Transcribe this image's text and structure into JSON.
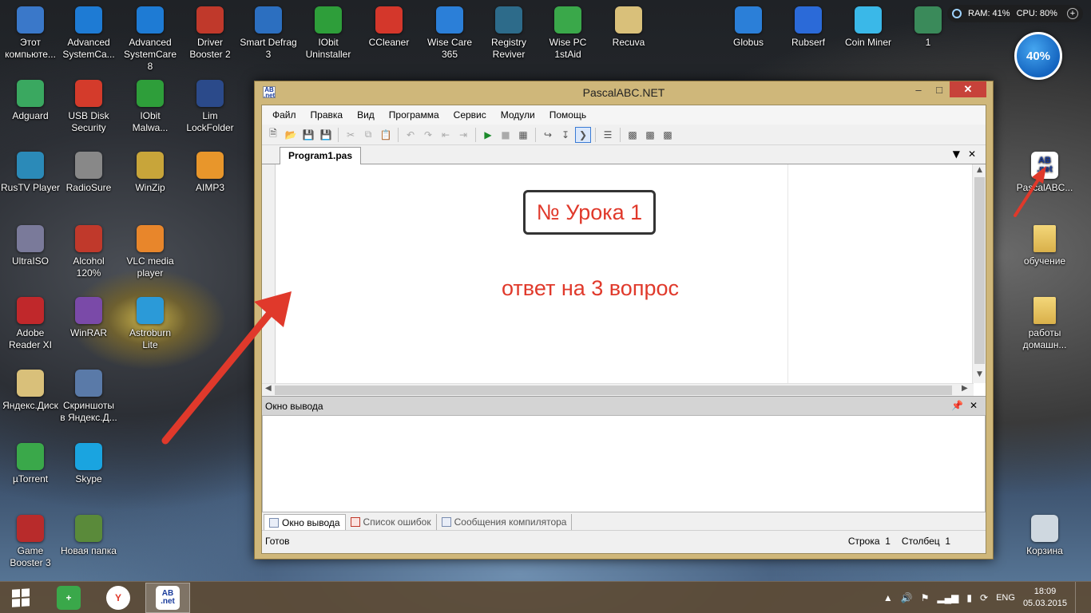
{
  "desktop": {
    "icons_left": [
      {
        "label": "Этот\nкомпьюте...",
        "icon": "computer-icon",
        "color": "#3a78c9"
      },
      {
        "label": "Advanced\nSystemCa...",
        "icon": "advanced-systemcare-icon",
        "color": "#1e7bd4"
      },
      {
        "label": "Advanced\nSystemCare 8",
        "icon": "advanced-systemcare8-icon",
        "color": "#1e7bd4"
      },
      {
        "label": "Driver\nBooster 2",
        "icon": "driver-booster-icon",
        "color": "#c0392b"
      },
      {
        "label": "Smart Defrag\n3",
        "icon": "smart-defrag-icon",
        "color": "#2c6fc0"
      },
      {
        "label": "IObit\nUninstaller",
        "icon": "iobit-uninstaller-icon",
        "color": "#2e9e3a"
      },
      {
        "label": "CCleaner",
        "icon": "ccleaner-icon",
        "color": "#d4372b"
      },
      {
        "label": "Wise Care\n365",
        "icon": "wise-care-icon",
        "color": "#2b7fd8"
      },
      {
        "label": "Registry\nReviver",
        "icon": "registry-reviver-icon",
        "color": "#2d6b8a"
      },
      {
        "label": "Wise PC\n1stAid",
        "icon": "wise-pc-1staid-icon",
        "color": "#3aa84a"
      },
      {
        "label": "Recuva",
        "icon": "recuva-icon",
        "color": "#d9c07a"
      },
      {
        "label": "Adguard",
        "icon": "adguard-icon",
        "color": "#3aa860"
      },
      {
        "label": "USB Disk\nSecurity",
        "icon": "usb-disk-security-icon",
        "color": "#d43b2b"
      },
      {
        "label": "IObit\nMalwa...",
        "icon": "iobit-malware-icon",
        "color": "#2e9e3a"
      },
      {
        "label": "Lim\nLockFolder",
        "icon": "lock-folder-icon",
        "color": "#2b4a8a"
      },
      {
        "label": "RusTV Player",
        "icon": "rustv-player-icon",
        "color": "#2b8ab8"
      },
      {
        "label": "RadioSure",
        "icon": "radiosure-icon",
        "color": "#888888"
      },
      {
        "label": "WinZip",
        "icon": "winzip-icon",
        "color": "#c8a53a"
      },
      {
        "label": "AIMP3",
        "icon": "aimp-icon",
        "color": "#e8962b"
      },
      {
        "label": "UltraISO",
        "icon": "ultraiso-icon",
        "color": "#7a7a9a"
      },
      {
        "label": "Alcohol\n120%",
        "icon": "alcohol-icon",
        "color": "#c0392b"
      },
      {
        "label": "VLC media\nplayer",
        "icon": "vlc-icon",
        "color": "#e8862b"
      },
      {
        "label": "Adobe\nReader XI",
        "icon": "adobe-reader-icon",
        "color": "#c0282b"
      },
      {
        "label": "WinRAR",
        "icon": "winrar-icon",
        "color": "#7a4aa8"
      },
      {
        "label": "Astroburn\nLite",
        "icon": "astroburn-icon",
        "color": "#2b9ad8"
      },
      {
        "label": "Яндекс.Диск",
        "icon": "yandex-disk-icon",
        "color": "#d9c07a"
      },
      {
        "label": "Скриншоты\nв Яндекс.Д...",
        "icon": "screenshots-icon",
        "color": "#5a7aa8"
      },
      {
        "label": "µTorrent",
        "icon": "utorrent-icon",
        "color": "#3aa84a"
      },
      {
        "label": "Skype",
        "icon": "skype-icon",
        "color": "#1aa4e0"
      },
      {
        "label": "Game\nBooster 3",
        "icon": "game-booster-icon",
        "color": "#b82b2b"
      },
      {
        "label": "Новая папка",
        "icon": "new-folder-icon",
        "color": "#5a8a3a"
      }
    ],
    "icons_right": [
      {
        "label": "Globus",
        "icon": "globus-icon",
        "color": "#2b7fd8"
      },
      {
        "label": "Rubserf",
        "icon": "rubserf-icon",
        "color": "#2b6ad8"
      },
      {
        "label": "Coin Miner",
        "icon": "coin-miner-icon",
        "color": "#3ab8e8"
      },
      {
        "label": "1",
        "icon": "monitor-icon",
        "color": "#3a8a5a"
      },
      {
        "label": "PascalABC...",
        "icon": "pascalabc-shortcut-icon",
        "color": "#ffffff"
      },
      {
        "label": "обучение",
        "icon": "folder-icon",
        "color": "#e8c860"
      },
      {
        "label": "работы\nдомашн...",
        "icon": "folder-icon",
        "color": "#e8c860"
      },
      {
        "label": "Корзина",
        "icon": "recycle-bin-icon",
        "color": "#cfd8e0"
      }
    ],
    "resources": {
      "ram": "RAM: 41%",
      "cpu": "CPU: 80%"
    },
    "gadget_percent": "40%",
    "arrow_color": "#e0392b"
  },
  "window": {
    "title": "PascalABC.NET",
    "menu": [
      "Файл",
      "Правка",
      "Вид",
      "Программа",
      "Сервис",
      "Модули",
      "Помощь"
    ],
    "doc_tab": "Program1.pas",
    "editor": {
      "lesson_label": "№ Урока 1",
      "answer_text": "ответ на 3 вопрос",
      "text_color": "#e0392b"
    },
    "output": {
      "header": "Окно вывода",
      "tabs": [
        "Окно вывода",
        "Список ошибок",
        "Сообщения компилятора"
      ]
    },
    "status": {
      "left": "Готов",
      "line_label": "Строка",
      "line_value": "1",
      "col_label": "Столбец",
      "col_value": "1"
    }
  },
  "taskbar": {
    "language": "ENG",
    "time": "18:09",
    "date": "05.03.2015"
  }
}
